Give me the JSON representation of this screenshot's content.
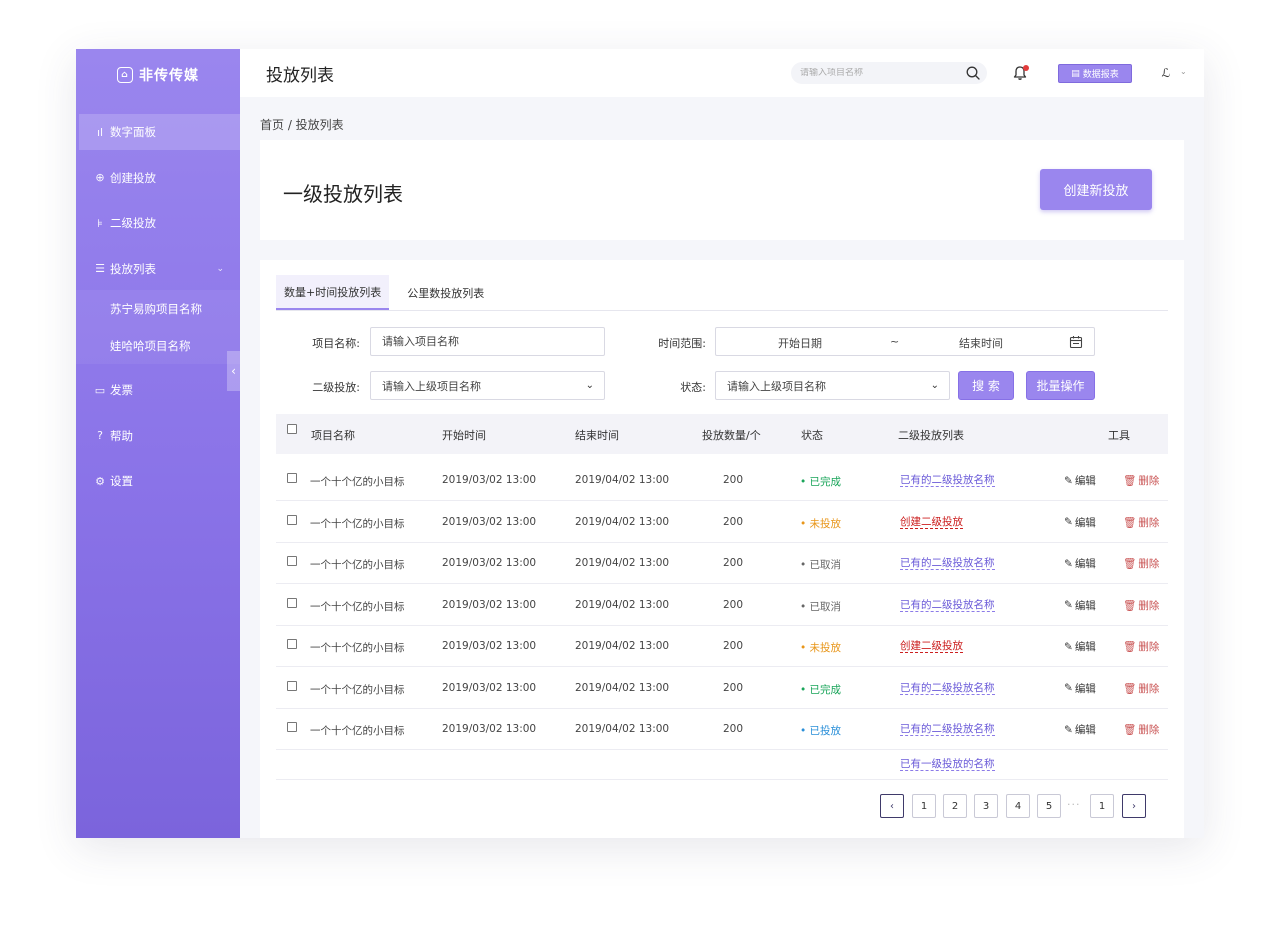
{
  "brand": {
    "name": "非传传媒"
  },
  "sidebar": {
    "items": [
      {
        "label": "数字面板",
        "icon": "bar-chart-icon",
        "glyph": "ıl"
      },
      {
        "label": "创建投放",
        "icon": "create-icon",
        "glyph": "⊕"
      },
      {
        "label": "二级投放",
        "icon": "tree-icon",
        "glyph": "⊧"
      },
      {
        "label": "投放列表",
        "icon": "list-icon",
        "glyph": "☰"
      },
      {
        "label": "发票",
        "icon": "invoice-icon",
        "glyph": "▭"
      },
      {
        "label": "帮助",
        "icon": "help-icon",
        "glyph": "?"
      },
      {
        "label": "设置",
        "icon": "settings-icon",
        "glyph": "⚙"
      }
    ],
    "sub_items": [
      {
        "label": "苏宁易购项目名称"
      },
      {
        "label": "娃哈哈项目名称"
      }
    ]
  },
  "header": {
    "title": "投放列表",
    "search_placeholder": "请输入项目名称",
    "report_button": "数据报表",
    "avatar_text": "ℒ"
  },
  "breadcrumb": "首页 / 投放列表",
  "main": {
    "title": "一级投放列表",
    "create_button": "创建新投放"
  },
  "tabs": [
    {
      "label": "数量+时间投放列表",
      "active": true
    },
    {
      "label": "公里数投放列表",
      "active": false
    }
  ],
  "filters": {
    "project_name_label": "项目名称:",
    "project_name_placeholder": "请输入项目名称",
    "time_range_label": "时间范围:",
    "start_date": "开始日期",
    "range_sep": "~",
    "end_date": "结束时间",
    "secondary_label": "二级投放:",
    "secondary_placeholder": "请输入上级项目名称",
    "status_label": "状态:",
    "status_placeholder": "请输入上级项目名称",
    "search_button": "搜 索",
    "batch_button": "批量操作"
  },
  "table": {
    "columns": [
      "项目名称",
      "开始时间",
      "结束时间",
      "投放数量/个",
      "状态",
      "二级投放列表",
      "工具"
    ],
    "edit_label": "编辑",
    "delete_label": "删除",
    "rows": [
      {
        "name": "一个十个亿的小目标",
        "start": "2019/03/02 13:00",
        "end": "2019/04/02 13:00",
        "qty": "200",
        "status": "已完成",
        "status_color": "#1aa55a",
        "sub": "已有的二级投放名称",
        "sub_kind": "link"
      },
      {
        "name": "一个十个亿的小目标",
        "start": "2019/03/02 13:00",
        "end": "2019/04/02 13:00",
        "qty": "200",
        "status": "未投放",
        "status_color": "#e8961a",
        "sub": "创建二级投放",
        "sub_kind": "create"
      },
      {
        "name": "一个十个亿的小目标",
        "start": "2019/03/02 13:00",
        "end": "2019/04/02 13:00",
        "qty": "200",
        "status": "已取消",
        "status_color": "#666666",
        "sub": "已有的二级投放名称",
        "sub_kind": "link"
      },
      {
        "name": "一个十个亿的小目标",
        "start": "2019/03/02 13:00",
        "end": "2019/04/02 13:00",
        "qty": "200",
        "status": "已取消",
        "status_color": "#666666",
        "sub": "已有的二级投放名称",
        "sub_kind": "link"
      },
      {
        "name": "一个十个亿的小目标",
        "start": "2019/03/02 13:00",
        "end": "2019/04/02 13:00",
        "qty": "200",
        "status": "未投放",
        "status_color": "#e8961a",
        "sub": "创建二级投放",
        "sub_kind": "create"
      },
      {
        "name": "一个十个亿的小目标",
        "start": "2019/03/02 13:00",
        "end": "2019/04/02 13:00",
        "qty": "200",
        "status": "已完成",
        "status_color": "#1aa55a",
        "sub": "已有的二级投放名称",
        "sub_kind": "link"
      },
      {
        "name": "一个十个亿的小目标",
        "start": "2019/03/02 13:00",
        "end": "2019/04/02 13:00",
        "qty": "200",
        "status": "已投放",
        "status_color": "#2a8fd8",
        "sub": "已有的二级投放名称",
        "sub_kind": "link"
      }
    ],
    "extra_link": "已有一级投放的名称"
  },
  "pagination": {
    "prev": "‹",
    "pages": [
      "1",
      "2",
      "3",
      "4",
      "5"
    ],
    "ellipsis": "···",
    "last": "1",
    "next": "›"
  }
}
